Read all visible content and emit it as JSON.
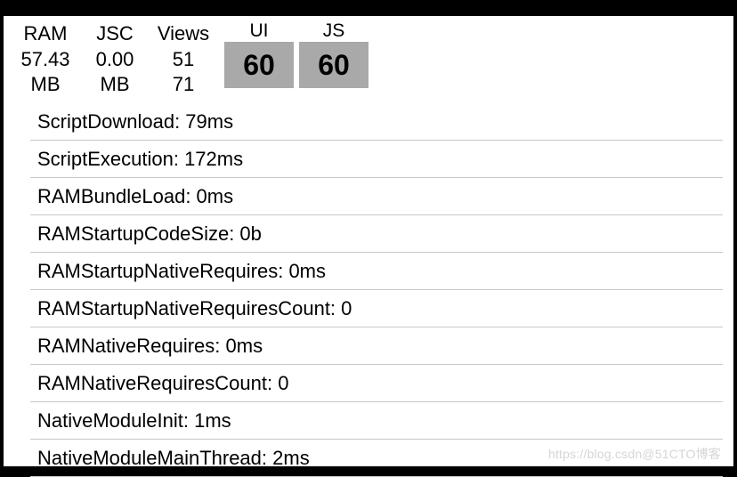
{
  "header": {
    "ram": {
      "label": "RAM",
      "value": "57.43",
      "unit": "MB"
    },
    "jsc": {
      "label": "JSC",
      "value": "0.00",
      "unit": "MB"
    },
    "views": {
      "label": "Views",
      "v1": "51",
      "v2": "71"
    },
    "ui": {
      "label": "UI",
      "fps": "60"
    },
    "js": {
      "label": "JS",
      "fps": "60"
    }
  },
  "metrics": [
    "ScriptDownload: 79ms",
    "ScriptExecution: 172ms",
    "RAMBundleLoad: 0ms",
    "RAMStartupCodeSize: 0b",
    "RAMStartupNativeRequires: 0ms",
    "RAMStartupNativeRequiresCount: 0",
    "RAMNativeRequires: 0ms",
    "RAMNativeRequiresCount: 0",
    "NativeModuleInit: 1ms",
    "NativeModuleMainThread: 2ms"
  ],
  "watermark": "https://blog.csdn@51CTO博客"
}
